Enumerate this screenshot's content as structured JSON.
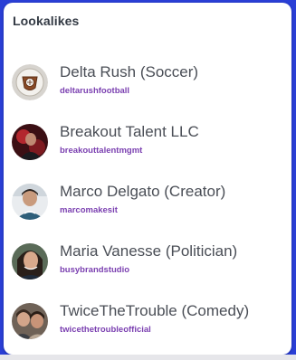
{
  "panel": {
    "title": "Lookalikes"
  },
  "items": [
    {
      "name": "Delta Rush (Soccer)",
      "handle": "deltarushfootball",
      "avatar": "soccer-club-logo-avatar"
    },
    {
      "name": "Breakout Talent LLC",
      "handle": "breakouttalentmgmt",
      "avatar": "person-photo-avatar"
    },
    {
      "name": "Marco Delgato (Creator)",
      "handle": "marcomakesit",
      "avatar": "person-photo-avatar"
    },
    {
      "name": "Maria Vanesse (Politician)",
      "handle": "busybrandstudio",
      "avatar": "person-photo-avatar"
    },
    {
      "name": "TwiceTheTrouble (Comedy)",
      "handle": "twicethetroubleofficial",
      "avatar": "person-photo-avatar"
    }
  ],
  "colors": {
    "background": "#2a3fd6",
    "handle": "#7a3fb0",
    "name": "#4a4e56"
  }
}
